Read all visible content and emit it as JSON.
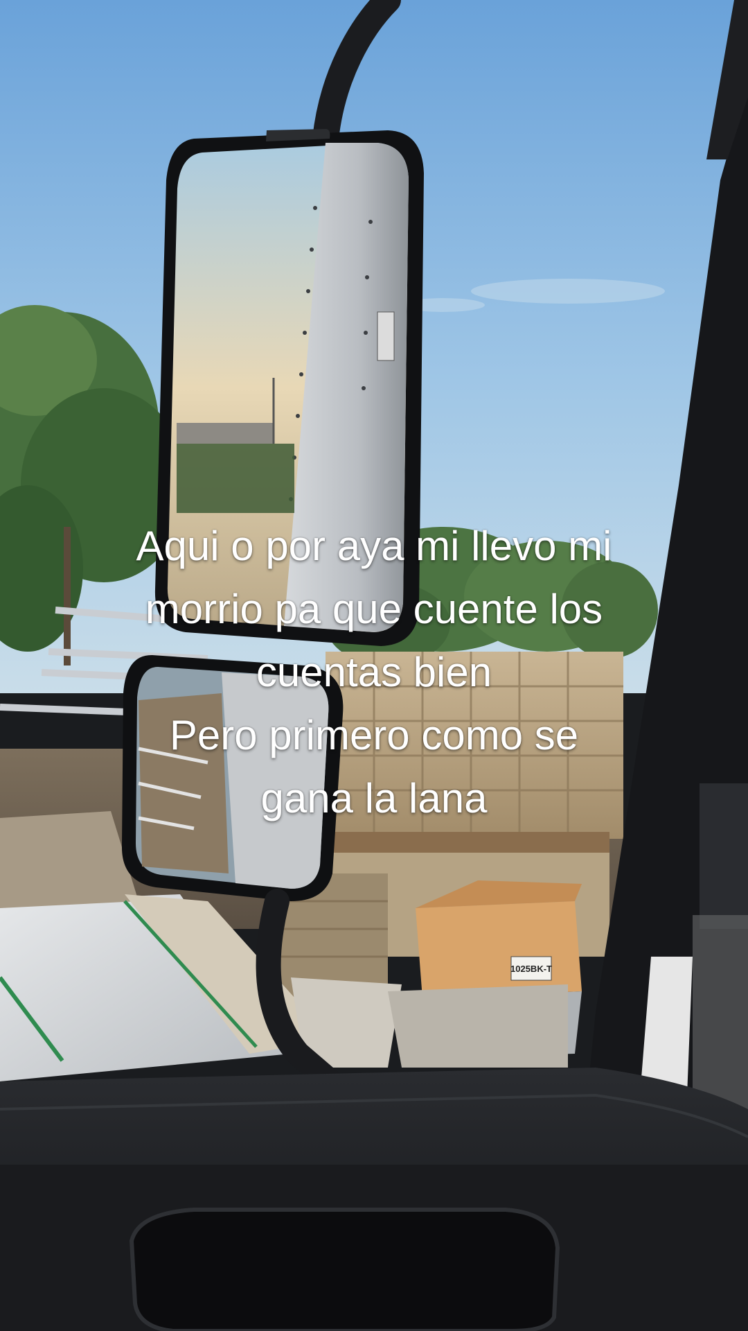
{
  "caption": {
    "lines": [
      "Aqui o por aya mi llevo mi",
      "morrio pa que cuente los",
      "cuentas bien",
      "Pero primero como se",
      "gana la lana"
    ]
  },
  "label": {
    "box_code": "1025BK-T"
  },
  "colors": {
    "sky_top": "#6fa6dc",
    "sky_bottom": "#b9d5ea",
    "caption_text": "#ffffff",
    "dashboard": "#1d1f22"
  }
}
